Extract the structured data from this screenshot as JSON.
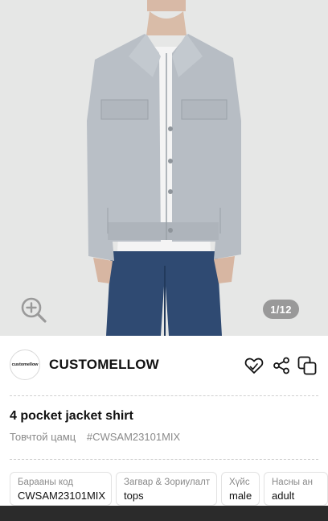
{
  "gallery": {
    "counter": "1/12",
    "zoom_icon": "zoom-in-icon"
  },
  "brand": {
    "logo_text": "customellow",
    "name": "CUSTOMELLOW",
    "actions": {
      "like_icon": "heart-icon",
      "share_icon": "share-icon",
      "copy_icon": "copy-icon"
    }
  },
  "product": {
    "title": "4 pocket jacket shirt",
    "category": "Товчтой цамц",
    "tag": "#CWSAM23101MIX"
  },
  "attributes": [
    {
      "label": "Барааны код",
      "value": "CWSAM23101MIX"
    },
    {
      "label": "Загвар & Зориулалт",
      "value": "tops"
    },
    {
      "label": "Хүйс",
      "value": "male"
    },
    {
      "label": "Насны ан",
      "value": "adult"
    }
  ],
  "colors": {
    "photo_bg": "#e6e7e6",
    "jacket": "#b9bfc6",
    "jeans": "#2f4a72"
  }
}
